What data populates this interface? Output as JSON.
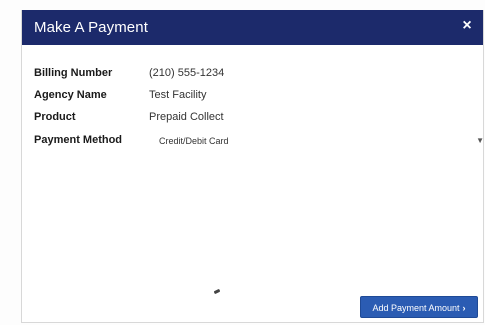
{
  "modal": {
    "title": "Make A Payment",
    "close_label": "×"
  },
  "fields": [
    {
      "label": "Billing Number",
      "value": "(210) 555-1234"
    },
    {
      "label": "Agency Name",
      "value": "Test Facility"
    },
    {
      "label": "Product",
      "value": "Prepaid Collect"
    }
  ],
  "payment_method": {
    "label": "Payment Method",
    "selected": "Credit/Debit Card",
    "caret": "▼"
  },
  "actions": {
    "add_payment_label": "Add Payment Amount",
    "add_payment_chevron": "›"
  },
  "colors": {
    "header_bg": "#1c2a6b",
    "button_bg": "#2b5cb3"
  },
  "icons": {
    "close": "close-icon",
    "dropdown": "chevron-down-icon",
    "next": "chevron-right-icon"
  }
}
